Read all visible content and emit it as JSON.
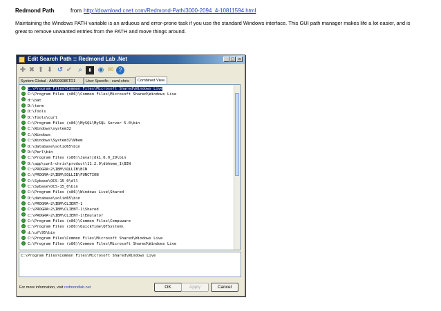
{
  "header": {
    "title": "Redmond Path",
    "from_label": "from",
    "url": "http://download.cnet.com/Redmond-Path/3000-2094_4-10811594.html"
  },
  "description": "Maintaining the Windows PATH variable is an arduous and error-prone task if you use the standard Windows interface. This GUI path manager makes life a lot easier, and is great to remove unwanted entries from the PATH and move things around.",
  "dialog": {
    "title": "Edit Search Path :: Redmond Lab .Net",
    "controls": {
      "minimize": "_",
      "maximize": "□",
      "close": "×"
    },
    "toolbar_icons": [
      "add-icon",
      "delete-icon",
      "move-up-icon",
      "move-down-icon",
      "undo-icon",
      "check-icon",
      "search-icon",
      "console-icon",
      "globe-icon",
      "mail-icon",
      "help-icon"
    ],
    "tabs": [
      "System Global - AMS09086TD1",
      "User Specific - cwnl-chris",
      "Combined View"
    ],
    "active_tab": 2,
    "paths": [
      "C:\\Program Files\\Common Files\\Microsoft Shared\\Windows Live",
      "C:\\Program Files (x86)\\Common Files\\Microsoft Shared\\Windows Live",
      "d:\\bat",
      "D:\\term",
      "D:\\Tools",
      "D:\\Tools\\curl",
      "C:\\Program Files (x86)\\MySQL\\MySQL Server 5.0\\bin",
      "C:\\Windows\\system32",
      "C:\\Windows",
      "C:\\Windows\\System32\\Wbem",
      "D:\\database\\solid65\\bin",
      "D:\\Perl\\bin",
      "C:\\Program Files (x86)\\Java\\jdk1.6.0_29\\bin",
      "D:\\app\\cwnl-chris\\product\\11.2.0\\dbhome_1\\BIN",
      "C:\\PROGRA~2\\IBM\\SQLLIB\\BIN",
      "C:\\PROGRA~2\\IBM\\SQLLIB\\FUNCTION",
      "C:\\Sybase\\OCS-15_0\\dll",
      "C:\\Sybase\\OCS-15_0\\bin",
      "C:\\Program Files (x86)\\Windows Live\\Shared",
      "D:\\database\\solid65\\bin",
      "C:\\PROGRA~2\\IBM\\CLIENT-1",
      "C:\\PROGRA~2\\IBM\\CLIENT-1\\Shared",
      "C:\\PROGRA~2\\IBM\\CLIENT-1\\Emulator",
      "C:\\Program Files (x86)\\Common Files\\Compuware",
      "C:\\Program Files (x86)\\QuickTime\\QTSystem\\",
      "d:\\uf\\95\\bin",
      "C:\\Program Files\\Common Files\\Microsoft Shared\\Windows Live",
      "C:\\Program Files (x86)\\Common Files\\Microsoft Shared\\Windows Live"
    ],
    "selected_index": 0,
    "edit_value": "C:\\Program Files\\Common Files\\Microsoft Shared\\Windows Live",
    "footer_text": "For more information, visit",
    "footer_link": "redmondlab.net",
    "buttons": {
      "ok": "OK",
      "apply": "Apply",
      "cancel": "Cancel"
    }
  }
}
